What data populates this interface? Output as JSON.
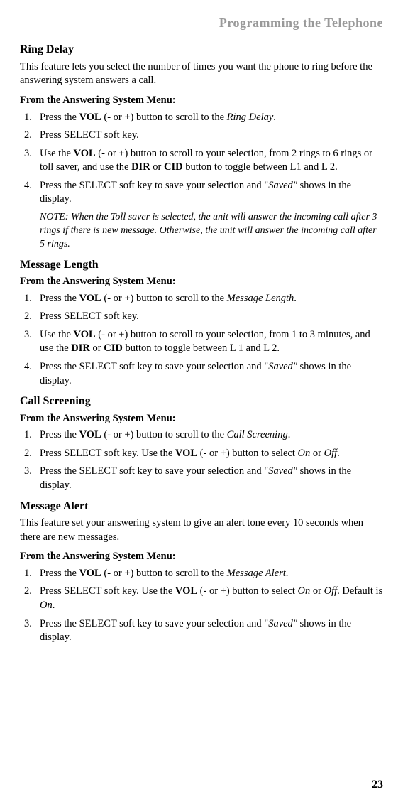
{
  "header": "Programming the Telephone",
  "sections": [
    {
      "title": "Ring Delay",
      "intro": "This feature lets you select the number of times you want the phone to ring before the answering system answers a call.",
      "subhead": "From the Answering System Menu:",
      "steps": [
        {
          "pre": "Press the ",
          "b1": "VOL",
          "mid1": " (- or +) button to scroll to the ",
          "i1": "Ring Delay",
          "post": "."
        },
        {
          "pre": "Press SELECT soft key."
        },
        {
          "pre": "Use the ",
          "b1": "VOL",
          "mid1": " (- or +) button to scroll to your selection, from 2 rings to 6 rings or toll saver, and use the ",
          "b2": "DIR",
          "mid2": " or ",
          "b3": "CID",
          "post": " button to toggle between L1 and L 2."
        },
        {
          "pre": "Press the SELECT soft key to save your selection and \"",
          "i1": "Saved\"",
          "post": " shows in the display."
        }
      ],
      "note": "NOTE: When the Toll saver is selected, the unit will answer the incoming call after 3 rings if there is new message. Otherwise, the unit will answer the incoming call after 5 rings."
    },
    {
      "title": "Message Length",
      "subhead": "From the Answering System Menu:",
      "steps": [
        {
          "pre": "Press the ",
          "b1": "VOL",
          "mid1": " (- or +) button to scroll to the ",
          "i1": "Message Length",
          "post": "."
        },
        {
          "pre": "Press SELECT soft key."
        },
        {
          "pre": "Use the ",
          "b1": "VOL",
          "mid1": " (- or +) button to scroll to your selection, from 1 to 3 minutes, and use the ",
          "b2": "DIR",
          "mid2": " or ",
          "b3": "CID",
          "post": " button to toggle between L 1 and L 2."
        },
        {
          "pre": "Press the SELECT soft key to save your selection and \"",
          "i1": "Saved\"",
          "post": " shows in the display."
        }
      ]
    },
    {
      "title": "Call Screening",
      "subhead": "From the Answering System Menu:",
      "steps": [
        {
          "pre": "Press the ",
          "b1": "VOL",
          "mid1": " (- or +) button to scroll to the ",
          "i1": "Call Screening",
          "post": "."
        },
        {
          "pre": "Press SELECT soft key. Use the ",
          "b1": "VOL",
          "mid1": " (- or +) button to select ",
          "i1": "On",
          "mid2": " or ",
          "i2": "Off",
          "post": "."
        },
        {
          "pre": "Press the SELECT soft key to save your selection and \"",
          "i1": "Saved\"",
          "post": " shows in the display."
        }
      ]
    },
    {
      "title": "Message Alert",
      "intro": "This feature set your answering system to give an alert tone every 10 seconds when there are new messages.",
      "subhead": "From the Answering System Menu:",
      "steps": [
        {
          "pre": "Press the ",
          "b1": "VOL",
          "mid1": " (- or +) button to scroll to the ",
          "i1": "Message Alert",
          "post": "."
        },
        {
          "pre": "Press SELECT soft key. Use the ",
          "b1": "VOL",
          "mid1": " (- or +) button to select ",
          "i1": "On",
          "mid2": " or ",
          "i2": "Off",
          "post": ". Default is ",
          "i3": "On",
          "post2": "."
        },
        {
          "pre": "Press the SELECT soft key to save your selection and \"",
          "i1": "Saved\"",
          "post": " shows in the display."
        }
      ]
    }
  ],
  "pageNumber": "23"
}
